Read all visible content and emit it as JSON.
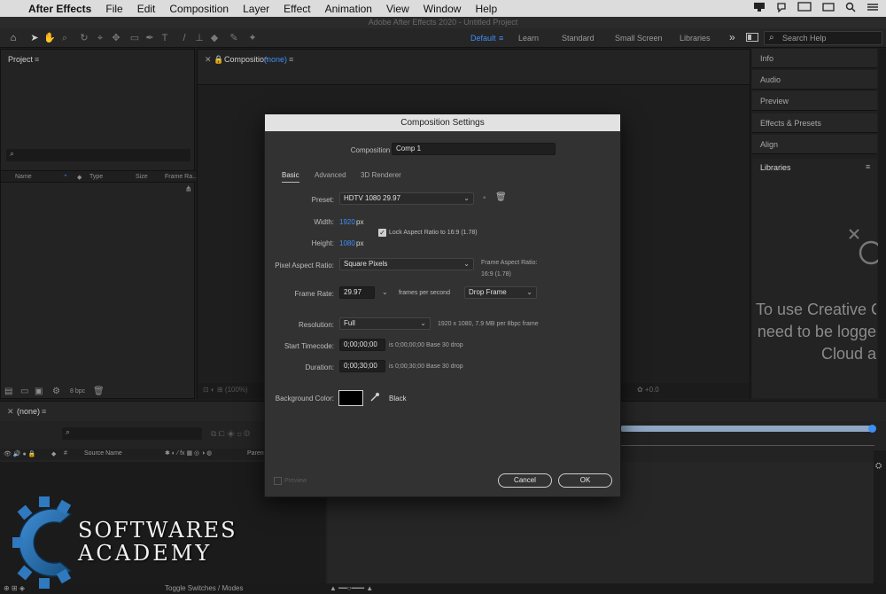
{
  "menubar": {
    "apple": "",
    "app_name": "After Effects",
    "items": [
      "File",
      "Edit",
      "Composition",
      "Layer",
      "Effect",
      "Animation",
      "View",
      "Window",
      "Help"
    ]
  },
  "window": {
    "title": "Adobe After Effects 2020 - Untitled Project"
  },
  "toolbar": {
    "workspaces": [
      "Default",
      "Learn",
      "Standard",
      "Small Screen",
      "Libraries"
    ],
    "workspace_active": "Default",
    "overflow": "»",
    "search_placeholder": "Search Help"
  },
  "project": {
    "title": "Project",
    "menu": "≡",
    "search_icon": "⌕",
    "columns": [
      "Name",
      "Type",
      "Size",
      "Frame Ra..."
    ],
    "bpc": "8 bpc"
  },
  "composition_viewer": {
    "tab_prefix": "Composition",
    "tab_value": "(none)",
    "menu": "≡"
  },
  "right_panels": {
    "items": [
      "Info",
      "Audio",
      "Preview",
      "Effects & Presets",
      "Align",
      "Libraries"
    ],
    "libraries_menu": "≡",
    "cc_message": [
      "To use Creative Cl",
      "need to be logge",
      "Cloud a"
    ]
  },
  "timeline": {
    "tab": "(none)",
    "menu": "≡",
    "source_name_col": "Source Name",
    "parent_col": "Parent",
    "footer_label": "Toggle Switches / Modes"
  },
  "logo": {
    "line1": "SOFTWARES",
    "line2": "ACADEMY"
  },
  "dialog": {
    "title": "Composition Settings",
    "comp_name_label": "Composition Name:",
    "comp_name_value": "Comp 1",
    "tabs": [
      "Basic",
      "Advanced",
      "3D Renderer"
    ],
    "active_tab": "Basic",
    "preset_label": "Preset:",
    "preset_value": "HDTV 1080 29.97",
    "width_label": "Width:",
    "width_value": "1920",
    "width_unit": "px",
    "height_label": "Height:",
    "height_value": "1080",
    "height_unit": "px",
    "lock_aspect_label": "Lock Aspect Ratio to 16:9 (1.78)",
    "lock_aspect_checked": true,
    "pixel_aspect_label": "Pixel Aspect Ratio:",
    "pixel_aspect_value": "Square Pixels",
    "frame_aspect_label": "Frame Aspect Ratio:",
    "frame_aspect_value": "16:9 (1.78)",
    "frame_rate_label": "Frame Rate:",
    "frame_rate_value": "29.97",
    "fps_label": "frames per second",
    "drop_frame_value": "Drop Frame",
    "resolution_label": "Resolution:",
    "resolution_value": "Full",
    "resolution_note": "1920 x 1080, 7.9 MB per 8bpc frame",
    "start_tc_label": "Start Timecode:",
    "start_tc_value": "0;00;00;00",
    "start_tc_note": "is 0;00;00;00  Base 30  drop",
    "duration_label": "Duration:",
    "duration_value": "0;00;30;00",
    "duration_note": "is 0;00;30;00  Base 30  drop",
    "bg_color_label": "Background Color:",
    "bg_color_name": "Black",
    "bg_color_hex": "#000000",
    "preview_label": "Preview",
    "cancel_label": "Cancel",
    "ok_label": "OK"
  },
  "colors": {
    "accent": "#3e8ef7",
    "dialog_bg": "#323232",
    "panel_bg": "#232323"
  }
}
